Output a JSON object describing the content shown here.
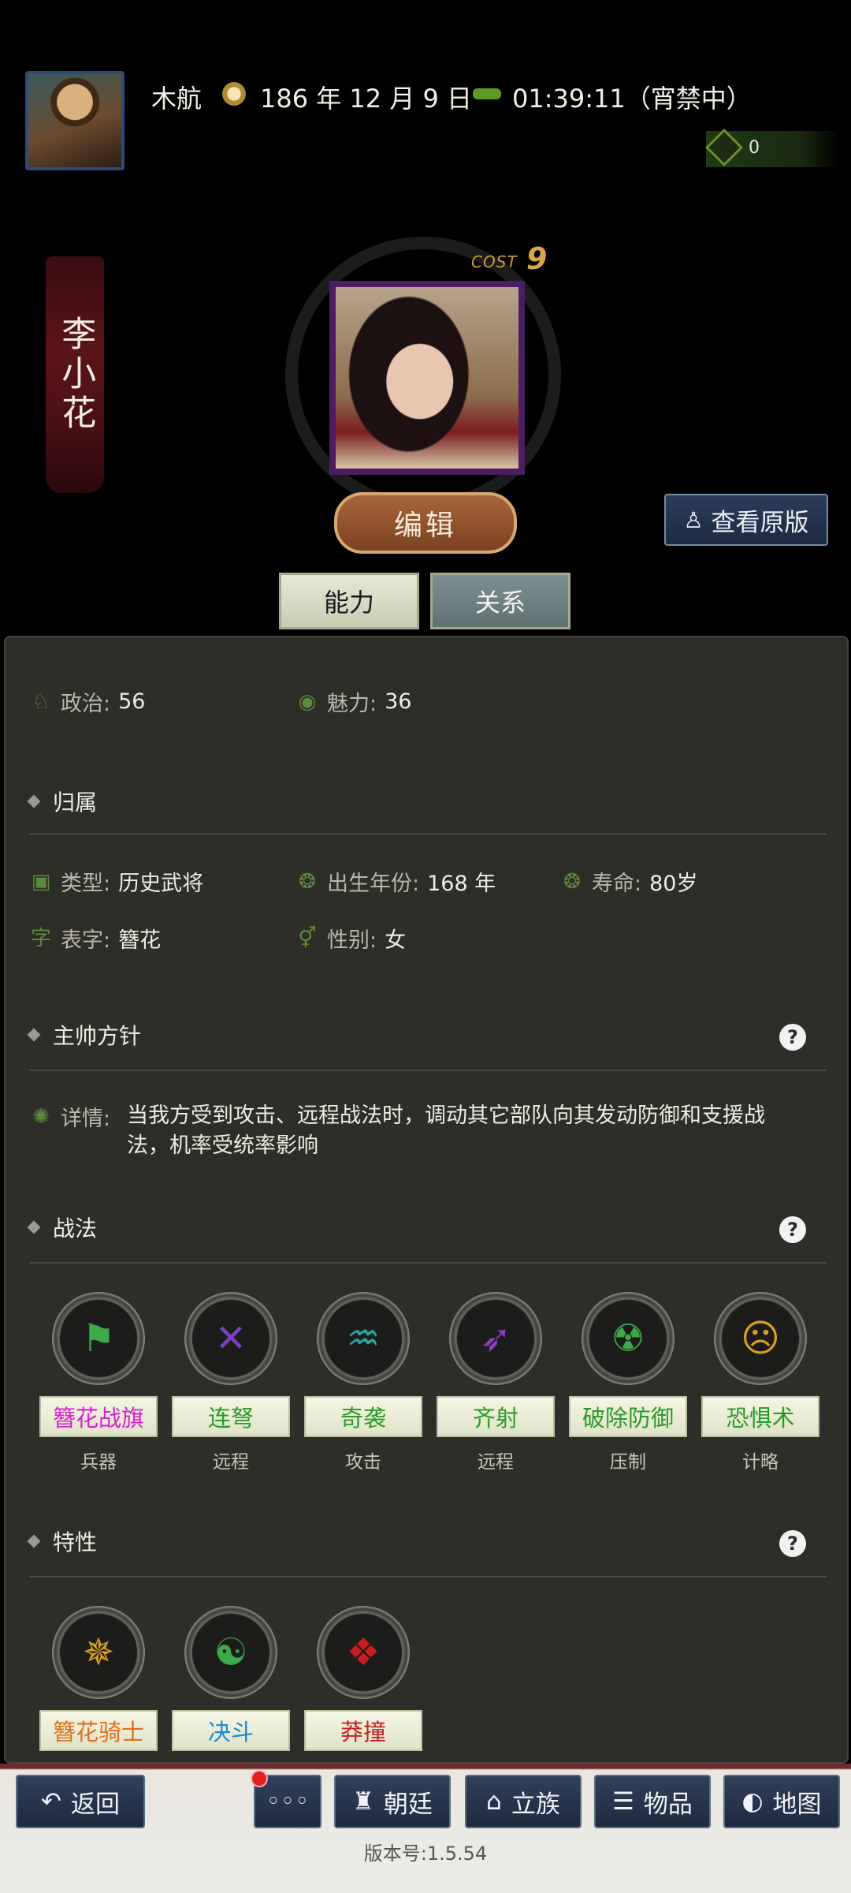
{
  "header": {
    "player_name": "木航",
    "date": "186 年 12 月 9 日",
    "time_status": "01:39:11（宵禁中）",
    "coin_count": "0"
  },
  "hero": {
    "name": "李小花",
    "cost_label": "COST",
    "cost_value": "9",
    "edit_label": "编辑",
    "view_original_label": "查看原版"
  },
  "tabs": [
    {
      "label": "能力",
      "active": true
    },
    {
      "label": "关系",
      "active": false
    }
  ],
  "stats": {
    "politics_label": "政治:",
    "politics_value": "56",
    "charm_label": "魅力:",
    "charm_value": "36"
  },
  "affiliation": {
    "title": "归属",
    "type_label": "类型:",
    "type_value": "历史武将",
    "birth_label": "出生年份:",
    "birth_value": "168 年",
    "lifespan_label": "寿命:",
    "lifespan_value": "80岁",
    "courtesy_label": "表字:",
    "courtesy_value": "簪花",
    "gender_label": "性别:",
    "gender_value": "女",
    "courtesy_icon": "字"
  },
  "policy": {
    "title": "主帅方针",
    "detail_label": "详情:",
    "detail_value": "当我方受到攻击、远程战法时，调动其它部队向其发动防御和支援战法，机率受统率影响"
  },
  "tactics": {
    "title": "战法",
    "items": [
      {
        "name": "簪花战旗",
        "type": "兵器",
        "color": "#d81ecf",
        "icon": "banner-icon"
      },
      {
        "name": "连弩",
        "type": "远程",
        "color": "#2a9a2a",
        "icon": "crossbow-icon"
      },
      {
        "name": "奇袭",
        "type": "攻击",
        "color": "#2a9a2a",
        "icon": "ambush-icon"
      },
      {
        "name": "齐射",
        "type": "远程",
        "color": "#2a9a2a",
        "icon": "volley-icon"
      },
      {
        "name": "破除防御",
        "type": "压制",
        "color": "#2a9a2a",
        "icon": "break-defense-icon"
      },
      {
        "name": "恐惧术",
        "type": "计略",
        "color": "#2a9a2a",
        "icon": "fear-icon"
      }
    ]
  },
  "traits": {
    "title": "特性",
    "items": [
      {
        "name": "簪花骑士",
        "color": "#e0701a",
        "icon": "knight-icon"
      },
      {
        "name": "决斗",
        "color": "#1a8ad8",
        "icon": "duel-icon"
      },
      {
        "name": "莽撞",
        "color": "#c81e1e",
        "icon": "reckless-icon"
      }
    ]
  },
  "bottom_nav": {
    "back": "返回",
    "more": "◦◦◦",
    "court": "朝廷",
    "clan": "立族",
    "items": "物品",
    "map": "地图"
  },
  "version": "版本号:1.5.54"
}
